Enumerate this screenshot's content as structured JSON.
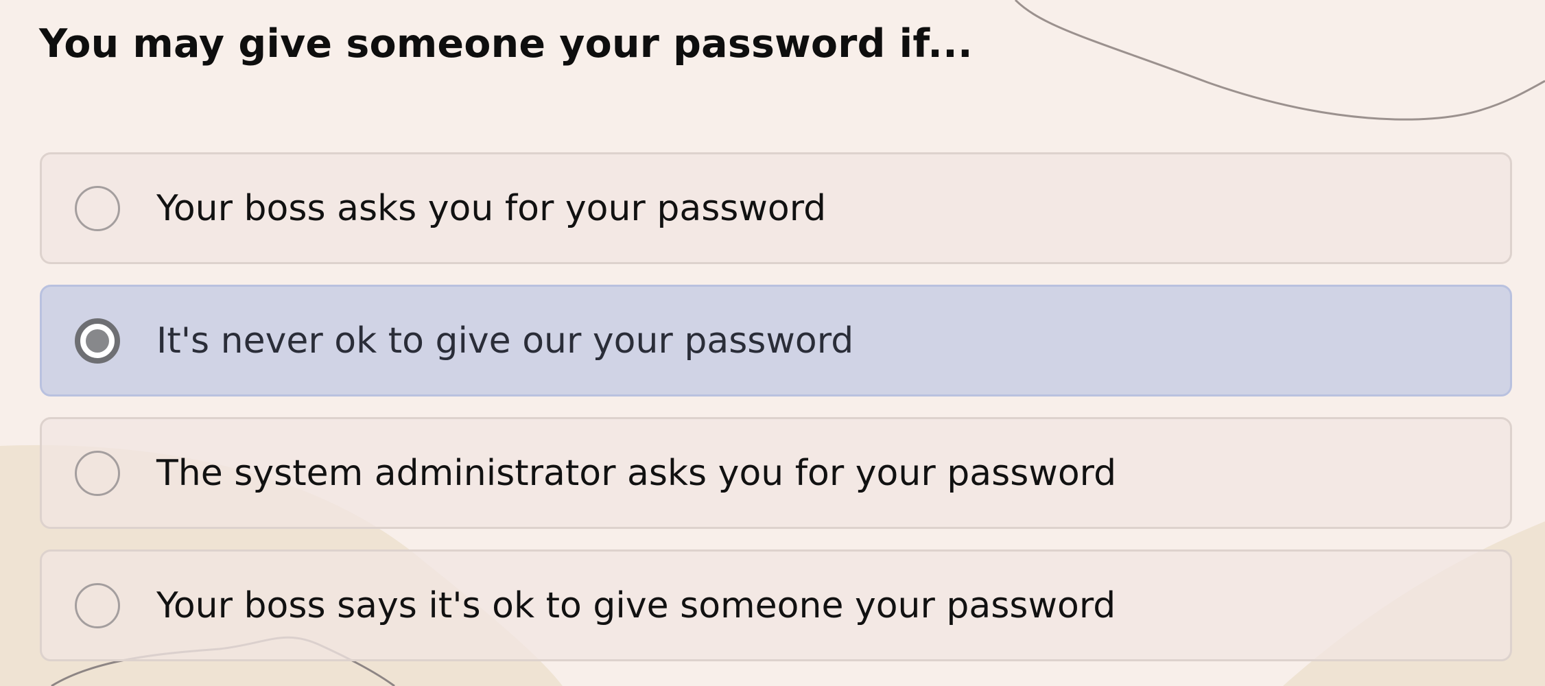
{
  "question": {
    "text": "You may give someone your password if..."
  },
  "options": [
    {
      "label": "Your boss asks you for your password",
      "selected": false
    },
    {
      "label": "It's never ok to give our your password",
      "selected": true
    },
    {
      "label": "The system administrator asks you for your password",
      "selected": false
    },
    {
      "label": "Your boss says it's ok to give someone your password",
      "selected": false
    }
  ],
  "colors": {
    "page_background": "#f8efea",
    "option_background": "#f1e6e2",
    "selected_option_background": "#d0d3e5",
    "selected_option_border": "#b9c1df",
    "text": "#111111"
  }
}
